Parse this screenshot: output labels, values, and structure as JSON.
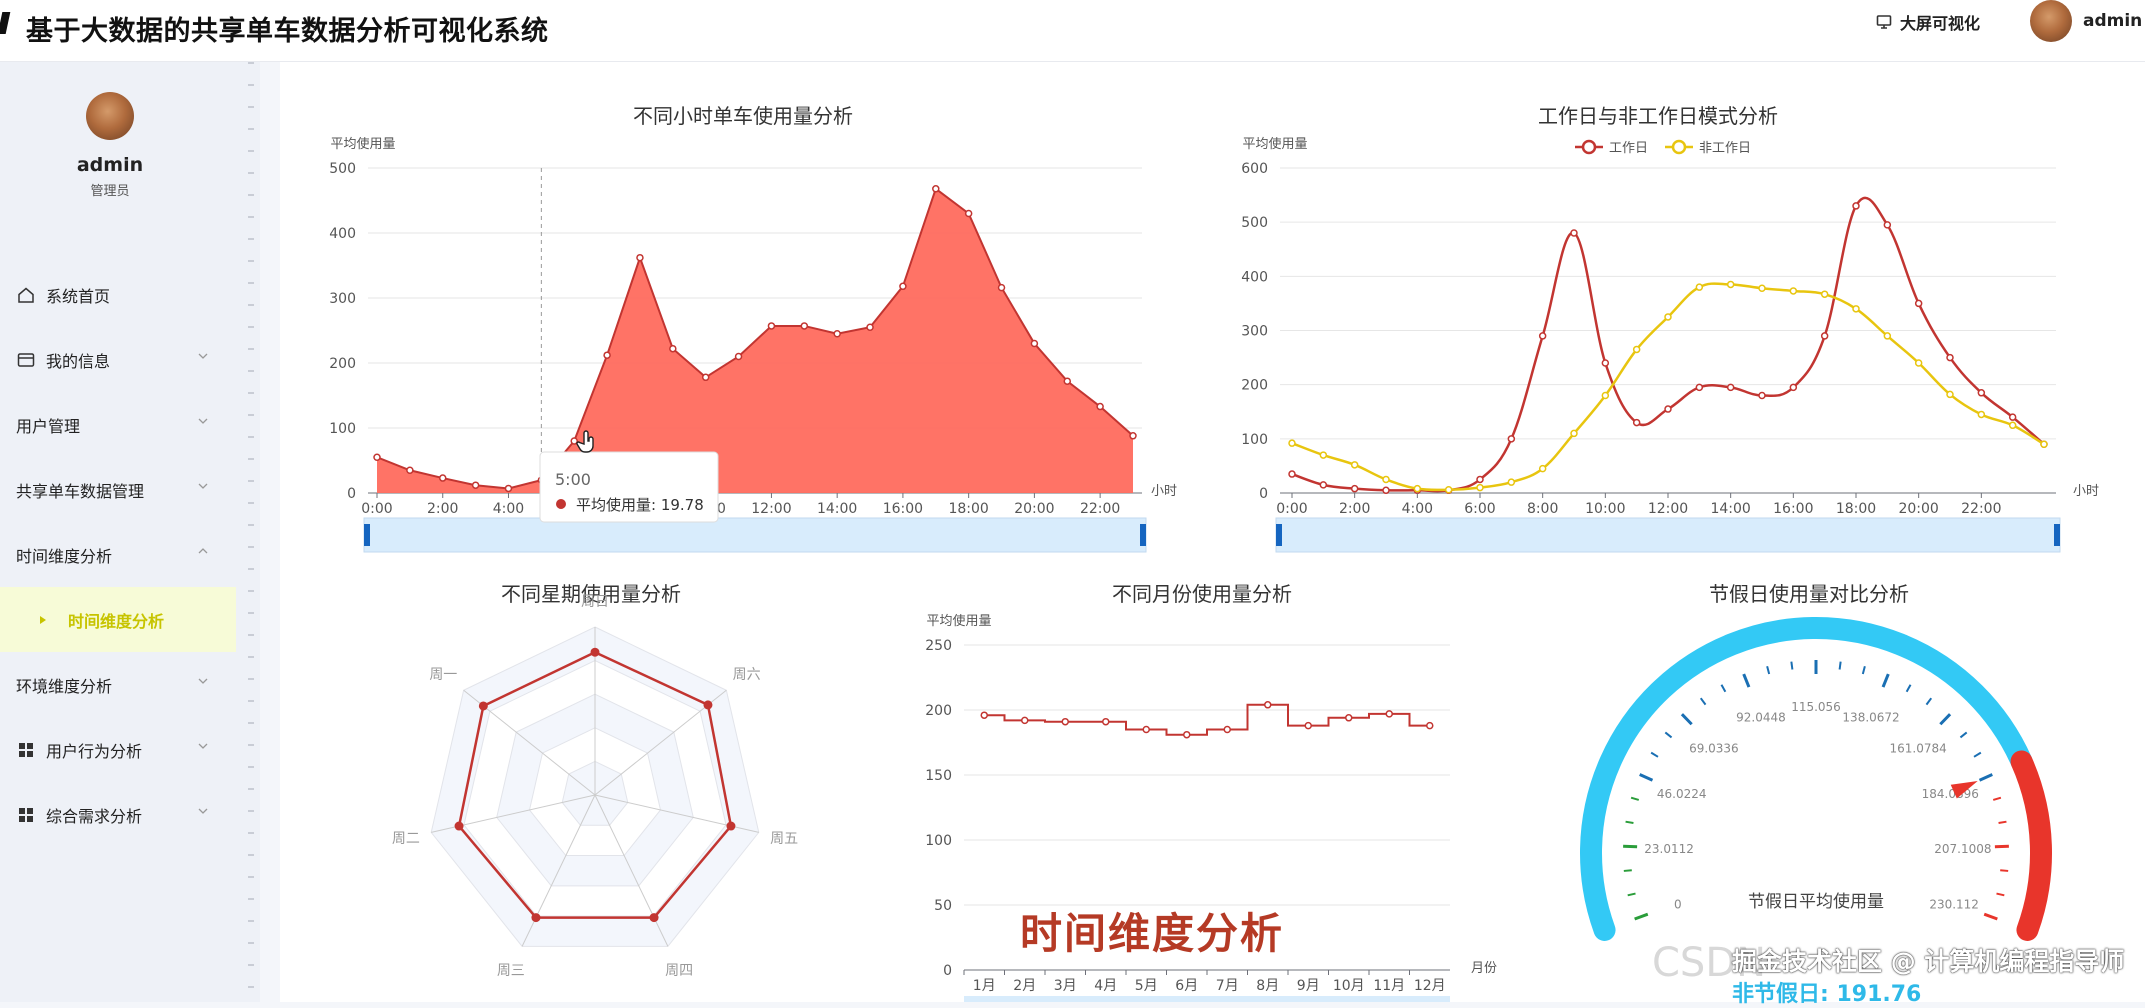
{
  "header": {
    "app_title": "基于大数据的共享单车数据分析可视化系统",
    "bigscreen_label": "大屏可视化",
    "user_name": "admin"
  },
  "sidebar": {
    "profile": {
      "name": "admin",
      "role": "管理员"
    },
    "items": [
      {
        "label": "系统首页",
        "icon": "home-icon"
      },
      {
        "label": "我的信息",
        "icon": "id-card-icon",
        "expandable": true
      },
      {
        "label": "用户管理",
        "expandable": true
      },
      {
        "label": "共享单车数据管理",
        "expandable": true
      },
      {
        "label": "时间维度分析",
        "expanded": true
      },
      {
        "label": "时间维度分析",
        "active": true,
        "sub": true
      },
      {
        "label": "环境维度分析",
        "expandable": true
      },
      {
        "label": "用户行为分析",
        "icon": "grid-icon",
        "expandable": true
      },
      {
        "label": "综合需求分析",
        "icon": "grid-icon",
        "expandable": true
      }
    ]
  },
  "colors": {
    "accent": "#c7c400",
    "red": "#c23531",
    "fill": "#ff6b5e",
    "yellow": "#e8c50f",
    "gauge_blue": "#33c9f5"
  },
  "watermark": "时间维度分析",
  "overlay": {
    "csdn": "CSDN",
    "juejin": "掘金技术社区 @ 计算机编程指导师",
    "holiday_value": "非节假日: 191.76"
  },
  "chart_data": [
    {
      "type": "area",
      "title": "不同小时单车使用量分析",
      "ylabel": "平均使用量",
      "xlabel": "小时",
      "ylim": [
        0,
        500
      ],
      "yticks": [
        "0",
        "100",
        "200",
        "300",
        "400",
        "500"
      ],
      "x": [
        "0:00",
        "1:00",
        "2:00",
        "3:00",
        "4:00",
        "5:00",
        "6:00",
        "7:00",
        "8:00",
        "9:00",
        "10:00",
        "11:00",
        "12:00",
        "13:00",
        "14:00",
        "15:00",
        "16:00",
        "17:00",
        "18:00",
        "19:00",
        "20:00",
        "21:00",
        "22:00",
        "23:00"
      ],
      "xtick_labels": [
        "0:00",
        "2:00",
        "4:00",
        "6:00",
        "8:00",
        "10:00",
        "12:00",
        "14:00",
        "16:00",
        "18:00",
        "20:00",
        "22:00"
      ],
      "values": [
        55,
        35,
        23,
        12,
        7,
        19.78,
        80,
        212,
        362,
        222,
        178,
        210,
        257,
        257,
        245,
        255,
        318,
        468,
        430,
        316,
        230,
        172,
        133,
        88
      ],
      "tooltip": {
        "title": "5:00",
        "label": "平均使用量: 19.78"
      }
    },
    {
      "type": "line",
      "title": "工作日与非工作日模式分析",
      "ylabel": "平均使用量",
      "xlabel": "小时",
      "ylim": [
        0,
        600
      ],
      "yticks": [
        "0",
        "100",
        "200",
        "300",
        "400",
        "500",
        "600"
      ],
      "xtick_labels": [
        "0:00",
        "2:00",
        "4:00",
        "6:00",
        "8:00",
        "10:00",
        "12:00",
        "14:00",
        "16:00",
        "18:00",
        "20:00",
        "22:00"
      ],
      "legend": [
        "工作日",
        "非工作日"
      ],
      "series": [
        {
          "name": "工作日",
          "values": [
            35,
            15,
            8,
            5,
            5,
            5,
            25,
            100,
            290,
            480,
            240,
            130,
            155,
            195,
            195,
            180,
            195,
            290,
            530,
            495,
            350,
            250,
            185,
            140,
            90
          ]
        },
        {
          "name": "非工作日",
          "values": [
            92,
            70,
            52,
            25,
            8,
            6,
            10,
            20,
            45,
            110,
            180,
            265,
            325,
            380,
            385,
            378,
            373,
            367,
            340,
            290,
            240,
            182,
            145,
            125,
            90
          ]
        }
      ]
    },
    {
      "type": "radar",
      "title": "不同星期使用量分析",
      "axes": [
        "周日",
        "周六",
        "周五",
        "周四",
        "周三",
        "周二",
        "周一"
      ],
      "values": [
        0.85,
        0.86,
        0.83,
        0.81,
        0.81,
        0.83,
        0.85
      ]
    },
    {
      "type": "line",
      "title": "不同月份使用量分析",
      "ylabel": "平均使用量",
      "xlabel": "月份",
      "ylim": [
        0,
        250
      ],
      "yticks": [
        "0",
        "50",
        "100",
        "150",
        "200",
        "250"
      ],
      "categories": [
        "1月",
        "2月",
        "3月",
        "4月",
        "5月",
        "6月",
        "7月",
        "8月",
        "9月",
        "10月",
        "11月",
        "12月"
      ],
      "values": [
        196,
        192,
        191,
        191,
        185,
        181,
        185,
        204,
        188,
        194,
        197,
        188
      ]
    },
    {
      "type": "gauge",
      "title": "节假日使用量对比分析",
      "label": "节假日平均使用量",
      "min": 0,
      "max": 230.112,
      "pointer": 184.0896,
      "tick_labels": [
        "0",
        "23.0112",
        "46.0224",
        "69.0336",
        "92.0448",
        "115.056",
        "138.0672",
        "161.0784",
        "184.0896",
        "207.1008",
        "230.112"
      ]
    }
  ]
}
